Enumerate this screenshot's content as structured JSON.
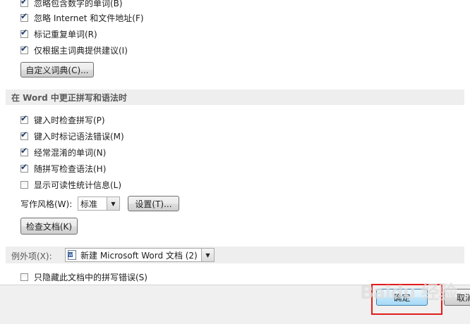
{
  "top_options": [
    {
      "label": "忽略包含数字的单词(B)",
      "checked": true
    },
    {
      "label": "忽略 Internet 和文件地址(F)",
      "checked": true
    },
    {
      "label": "标记重复单词(R)",
      "checked": true
    },
    {
      "label": "仅根据主词典提供建议(I)",
      "checked": true
    }
  ],
  "custom_dict_button": "自定义词典(C)...",
  "word_section_title": "在 Word 中更正拼写和语法时",
  "word_options": [
    {
      "label": "键入时检查拼写(P)",
      "checked": true
    },
    {
      "label": "键入时标记语法错误(M)",
      "checked": true
    },
    {
      "label": "经常混淆的单词(N)",
      "checked": true
    },
    {
      "label": "随拼写检查语法(H)",
      "checked": true
    },
    {
      "label": "显示可读性统计信息(L)",
      "checked": false
    }
  ],
  "writing_style": {
    "label": "写作风格(W):",
    "value": "标准",
    "settings_button": "设置(T)..."
  },
  "check_document_button": "检查文档(K)",
  "exceptions": {
    "label": "例外项(X):",
    "document": "新建 Microsoft Word 文档 (2)",
    "hide_errors": {
      "label": "只隐藏此文档中的拼写错误(S)",
      "checked": false
    }
  },
  "footer": {
    "ok_button": "确定",
    "cancel_button": "取消"
  },
  "watermark": "Baidu 经验",
  "colors": {
    "highlight_border": "#e31b1b",
    "section_bg": "#eeeeee",
    "footer_bg": "#f0f0f0"
  }
}
